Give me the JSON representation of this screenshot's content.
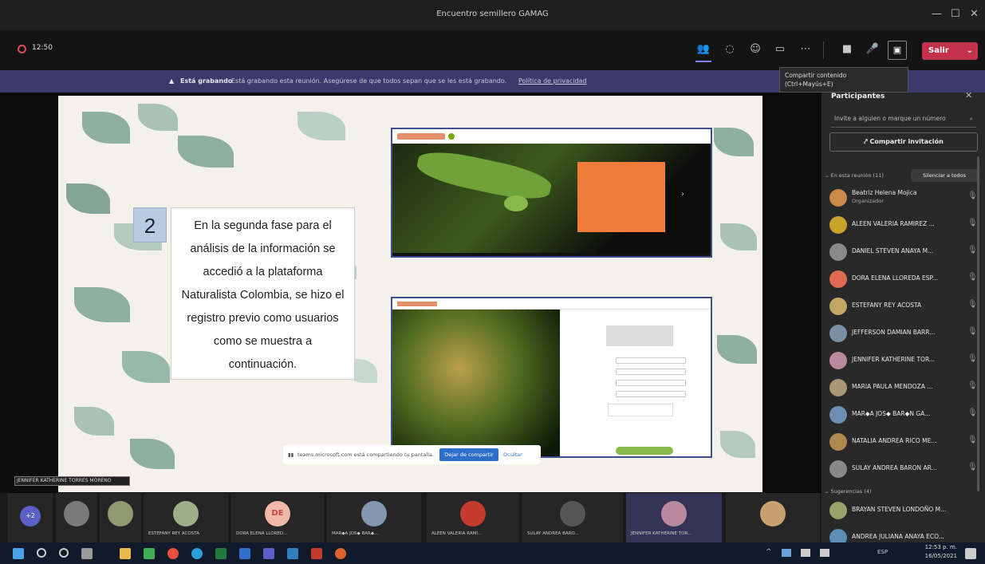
{
  "window": {
    "title": "Encuentro semillero GAMAG",
    "minimize": "—",
    "maximize": "☐",
    "close": "✕"
  },
  "toolbar": {
    "timer": "12:50",
    "leave_label": "Salir"
  },
  "recording_banner": {
    "bold": "Está grabando",
    "text": "Está grabando esta reunión. Asegúrese de que todos sepan que se les está grabando.",
    "link": "Política de privacidad"
  },
  "tooltip": {
    "line1": "Compartir contenido",
    "line2": "(Ctrl+Mayús+E)"
  },
  "slide": {
    "number": "2",
    "body": "En la segunda fase para el análisis de la información se accedió a la plataforma Naturalista Colombia, se hizo el registro previo como usuarios como se muestra a continuación."
  },
  "share_bar": {
    "text": "teams.microsoft.com está compartiendo tu pantalla.",
    "stop_label": "Dejar de compartir",
    "hide_label": "Ocultar"
  },
  "presenter_label": "JENNIFER KATHERINE TORRES MORENO",
  "panel": {
    "header": "Participantes",
    "invite_placeholder": "Invite a alguien o marque un número",
    "share_invite": "Compartir invitación",
    "in_meeting_label": "En esta reunión (11)",
    "mute_all": "Silenciar a todos",
    "organizer_role": "Organizador",
    "suggested_label": "Sugerencias (4)",
    "participants": [
      {
        "name": "Beatriz Helena Mojica",
        "color": "#c98a4a"
      },
      {
        "name": "ALEEN VALERIA RAMIREZ ...",
        "color": "#c9a227"
      },
      {
        "name": "DANIEL STEVEN ANAYA M...",
        "color": "#8a8a8a"
      },
      {
        "name": "DORA ELENA LLOREDA ESP...",
        "color": "#e0694f"
      },
      {
        "name": "ESTEFANY REY ACOSTA",
        "color": "#c2a866"
      },
      {
        "name": "JEFFERSON DAMIAN BARR...",
        "color": "#7d8fa3"
      },
      {
        "name": "JENNIFER KATHERINE TOR...",
        "color": "#b98a9c"
      },
      {
        "name": "MARIA PAULA MENDOZA ...",
        "color": "#a89675"
      },
      {
        "name": "MAR◆A JOS◆ BAR◆N GA...",
        "color": "#6f8fb0"
      },
      {
        "name": "NATALIA ANDREA RICO ME...",
        "color": "#b0884f"
      },
      {
        "name": "SULAY ANDREA BARON AR...",
        "color": "#888888"
      }
    ],
    "suggested": [
      {
        "name": "BRAYAN STEVEN LONDOÑO M...",
        "color": "#9aa36a"
      },
      {
        "name": "ANDREA JULIANA ANAYA ECO...",
        "color": "#5a8fb8"
      }
    ]
  },
  "gallery": [
    {
      "label": "+2",
      "color": "#5b5fc7"
    },
    {
      "label": "",
      "color": "#7a7a7a"
    },
    {
      "label": "",
      "color": "#8f9a70"
    },
    {
      "label": "ESTEFANY REY ACOSTA",
      "color": "#9bb08a"
    },
    {
      "label": "DORA ELENA LLORED...",
      "color": "#f1b9a8",
      "initials": "DE"
    },
    {
      "label": "MAR◆A JOS◆ BAR◆...",
      "color": "#8496b0"
    },
    {
      "label": "ALEEN VALERIA RAMI...",
      "color": "#c43b2e"
    },
    {
      "label": "SULAY ANDREA BARO...",
      "color": "#555555"
    },
    {
      "label": "JENNIFER KATHERINE TOR...",
      "color": "#b98a9c"
    },
    {
      "label": "",
      "color": "#c9a070"
    }
  ],
  "taskbar": {
    "time": "12:53 p. m.",
    "date": "16/05/2021",
    "lang": "ESP"
  }
}
